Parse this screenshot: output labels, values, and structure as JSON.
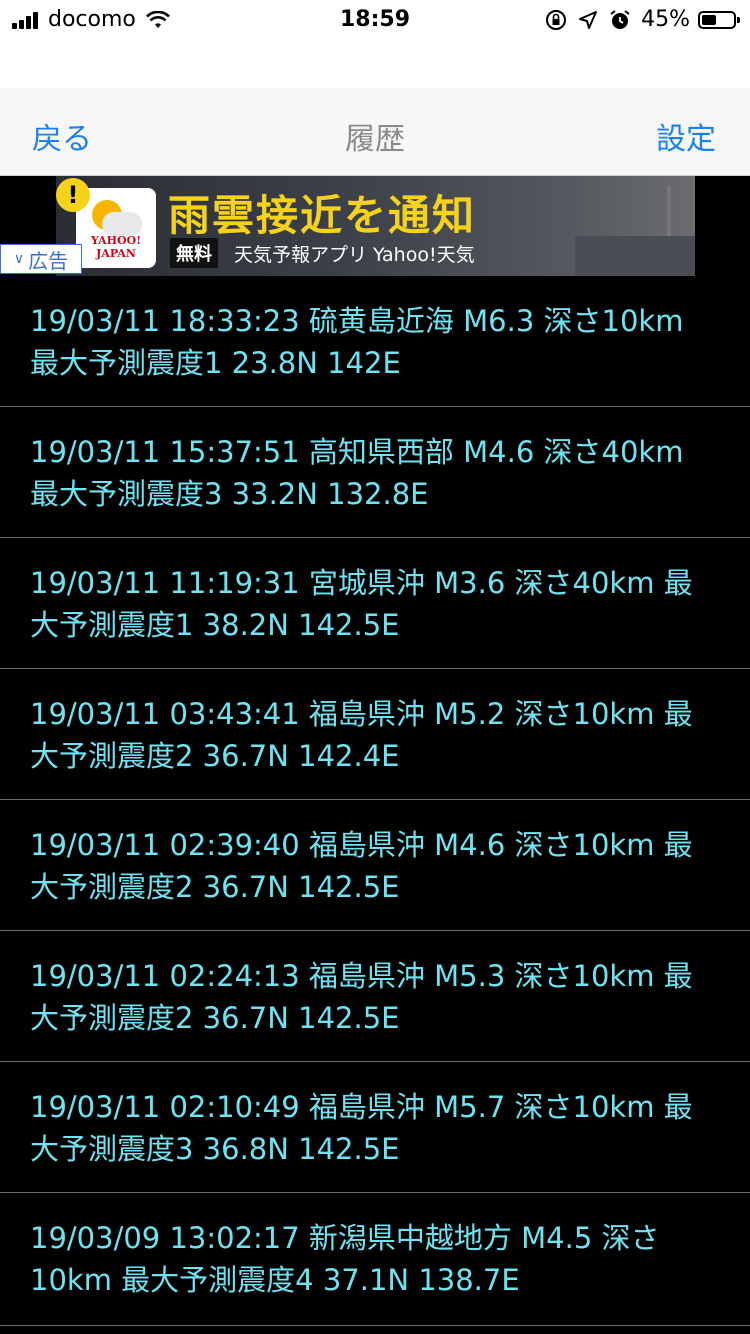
{
  "status_bar": {
    "carrier": "docomo",
    "time": "18:59",
    "battery_percent": "45%",
    "battery_level": 0.45,
    "icons": [
      "signal-icon",
      "wifi-icon",
      "orientation-lock-icon",
      "location-icon",
      "alarm-icon",
      "battery-icon"
    ]
  },
  "nav": {
    "back_label": "戻る",
    "title": "履歴",
    "settings_label": "設定"
  },
  "ad": {
    "badge_label": "広告",
    "headline": "雨雲接近を通知",
    "free_label": "無料",
    "subtitle": "天気予報アプリ Yahoo!天気",
    "logo_text": "YAHOO! JAPAN",
    "warning": "!"
  },
  "history": [
    "19/03/11 18:33:23 硫黄島近海 M6.3 深さ10km 最大予測震度1 23.8N 142E",
    "19/03/11 15:37:51 高知県西部 M4.6 深さ40km 最大予測震度3 33.2N 132.8E",
    "19/03/11 11:19:31 宮城県沖 M3.6 深さ40km 最大予測震度1 38.2N 142.5E",
    "19/03/11 03:43:41 福島県沖 M5.2 深さ10km 最大予測震度2 36.7N 142.4E",
    "19/03/11 02:39:40 福島県沖 M4.6 深さ10km 最大予測震度2 36.7N 142.5E",
    "19/03/11 02:24:13 福島県沖 M5.3 深さ10km 最大予測震度2 36.7N 142.5E",
    "19/03/11 02:10:49 福島県沖 M5.7 深さ10km 最大予測震度3 36.8N 142.5E",
    "19/03/09 13:02:17 新潟県中越地方 M4.5 深さ10km 最大予測震度4 37.1N 138.7E"
  ],
  "colors": {
    "accent": "#1a7ff0",
    "list_text": "#6fe3f2",
    "background": "#000000",
    "ad_headline": "#f7d21a"
  }
}
